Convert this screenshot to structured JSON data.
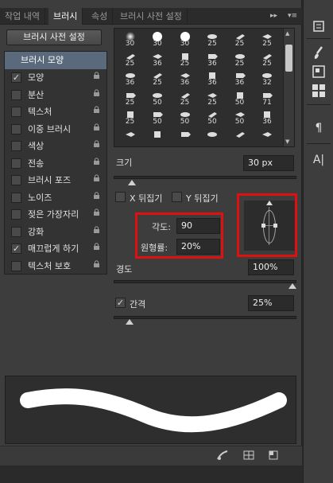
{
  "tabs": [
    {
      "label": "작업 내역",
      "active": false
    },
    {
      "label": "브러시",
      "active": true
    },
    {
      "label": "속성",
      "active": false
    },
    {
      "label": "브러시 사전 설정",
      "active": false
    }
  ],
  "panel_menu": "▾≡",
  "panel_collapse": "▸▸",
  "preset_button": "브러시 사전 설정",
  "left_list": {
    "header": "브러시 모양",
    "items": [
      {
        "label": "모양",
        "checked": true,
        "locked": true
      },
      {
        "label": "분산",
        "checked": false,
        "locked": true
      },
      {
        "label": "텍스처",
        "checked": false,
        "locked": true
      },
      {
        "label": "이중 브러시",
        "checked": false,
        "locked": true
      },
      {
        "label": "색상",
        "checked": false,
        "locked": true
      },
      {
        "label": "전송",
        "checked": false,
        "locked": true
      },
      {
        "label": "브러시 포즈",
        "checked": false,
        "locked": true
      },
      {
        "label": "노이즈",
        "checked": false,
        "locked": true
      },
      {
        "label": "젖은 가장자리",
        "checked": false,
        "locked": true
      },
      {
        "label": "강화",
        "checked": false,
        "locked": true
      },
      {
        "label": "매끄럽게 하기",
        "checked": true,
        "locked": true
      },
      {
        "label": "텍스처 보호",
        "checked": false,
        "locked": true
      }
    ]
  },
  "brush_grid": [
    [
      "30",
      "30",
      "30",
      "25",
      "25",
      "25"
    ],
    [
      "25",
      "36",
      "25",
      "36",
      "25",
      "25"
    ],
    [
      "36",
      "25",
      "36",
      "36",
      "36",
      "32"
    ],
    [
      "25",
      "50",
      "25",
      "25",
      "50",
      "71"
    ],
    [
      "25",
      "50",
      "50",
      "50",
      "50",
      "36"
    ],
    [
      "",
      "",
      "",
      "",
      "",
      ""
    ]
  ],
  "size": {
    "label": "크기",
    "value": "30 px"
  },
  "flip_x": {
    "label": "X 뒤집기",
    "checked": false
  },
  "flip_y": {
    "label": "Y 뒤집기",
    "checked": false
  },
  "angle": {
    "label": "각도:",
    "value": "90"
  },
  "roundness": {
    "label": "원형률:",
    "value": "20%"
  },
  "hardness": {
    "label": "경도",
    "value": "100%"
  },
  "spacing": {
    "label": "간격",
    "value": "25%",
    "checked": true
  },
  "sliders": {
    "size": 0.08,
    "hardness": 1.0,
    "spacing": 0.07
  },
  "colors": {
    "panel_bg": "#3d3d3d",
    "highlight": "#e01010",
    "selected": "#5a6a7c"
  },
  "bottom_icons": [
    "brush-toggle-icon",
    "grid-icon",
    "new-preset-icon"
  ],
  "sidebar_icons": [
    "history-icon",
    "brush-icon",
    "properties-icon",
    "brush-presets-icon",
    "paragraph-icon",
    "character-icon"
  ]
}
